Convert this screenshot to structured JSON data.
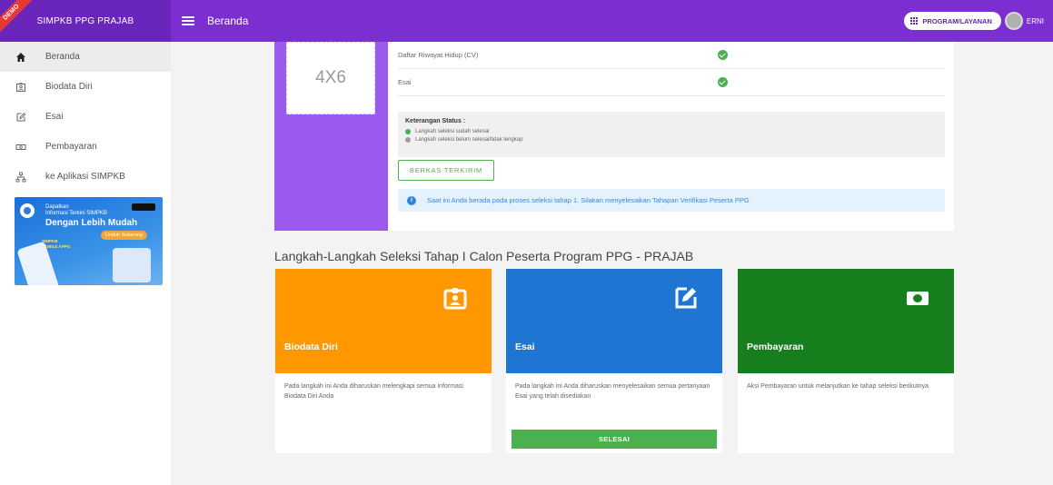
{
  "topbar": {
    "brand": "SIMPKB PPG PRAJAB",
    "ribbon": "DEMO",
    "page_title": "Beranda",
    "program_button": "PROGRAM/LAYANAN",
    "user_name": "ERNI"
  },
  "sidebar": {
    "items": [
      {
        "label": "Beranda",
        "icon": "home-icon"
      },
      {
        "label": "Biodata Diri",
        "icon": "id-card-icon"
      },
      {
        "label": "Esai",
        "icon": "edit-icon"
      },
      {
        "label": "Pembayaran",
        "icon": "money-icon"
      },
      {
        "label": "ke Aplikasi SIMPKB",
        "icon": "sitemap-icon"
      }
    ],
    "promo": {
      "line1": "Dapatkan",
      "line2": "Informasi Terkini SIMPKB",
      "line3": "Dengan Lebih Mudah",
      "cta": "Unduh Sekarang",
      "app_name": "SIMPKB MOBILE APPS"
    }
  },
  "profile": {
    "photo_placeholder": "4X6",
    "documents": [
      {
        "label": "Daftar Riwayat Hidup (CV)",
        "status": "done"
      },
      {
        "label": "Esai",
        "status": "done"
      }
    ],
    "legend": {
      "title": "Keterangan Status :",
      "done": "Langkah seleksi sudah selesai",
      "pending": "Langkah seleksi belum selesai/tidak lengkap"
    },
    "submitted_button": "BERKAS TERKIRIM",
    "info": "Saat ini Anda berada pada proses seleksi tahap 1. Silakan menyelesaikan Tahapan Verifikasi Peserta PPG"
  },
  "steps_section": {
    "title": "Langkah-Langkah Seleksi Tahap I Calon Peserta Program PPG - PRAJAB",
    "cards": [
      {
        "title": "Biodata Diri",
        "description": "Pada langkah ini Anda diharuskan melengkapi semua informasi Biodata Diri Anda",
        "color": "#ff9800",
        "icon": "id-badge-icon"
      },
      {
        "title": "Esai",
        "description": "Pada langkah ini Anda diharuskan menyelesaikan semua pertanyaan Esai yang telah disediakan",
        "color": "#1e76d2",
        "icon": "edit-square-icon",
        "button": "SELESAI"
      },
      {
        "title": "Pembayaran",
        "description": "Aksi Pembayaran untuk melanjutkan ke tahap seleksi berikutnya",
        "color": "#167e1c",
        "icon": "banknote-icon"
      }
    ]
  },
  "colors": {
    "topbar": "#7b2fd0",
    "photo_column": "#9b59f0",
    "success": "#4caf50"
  }
}
